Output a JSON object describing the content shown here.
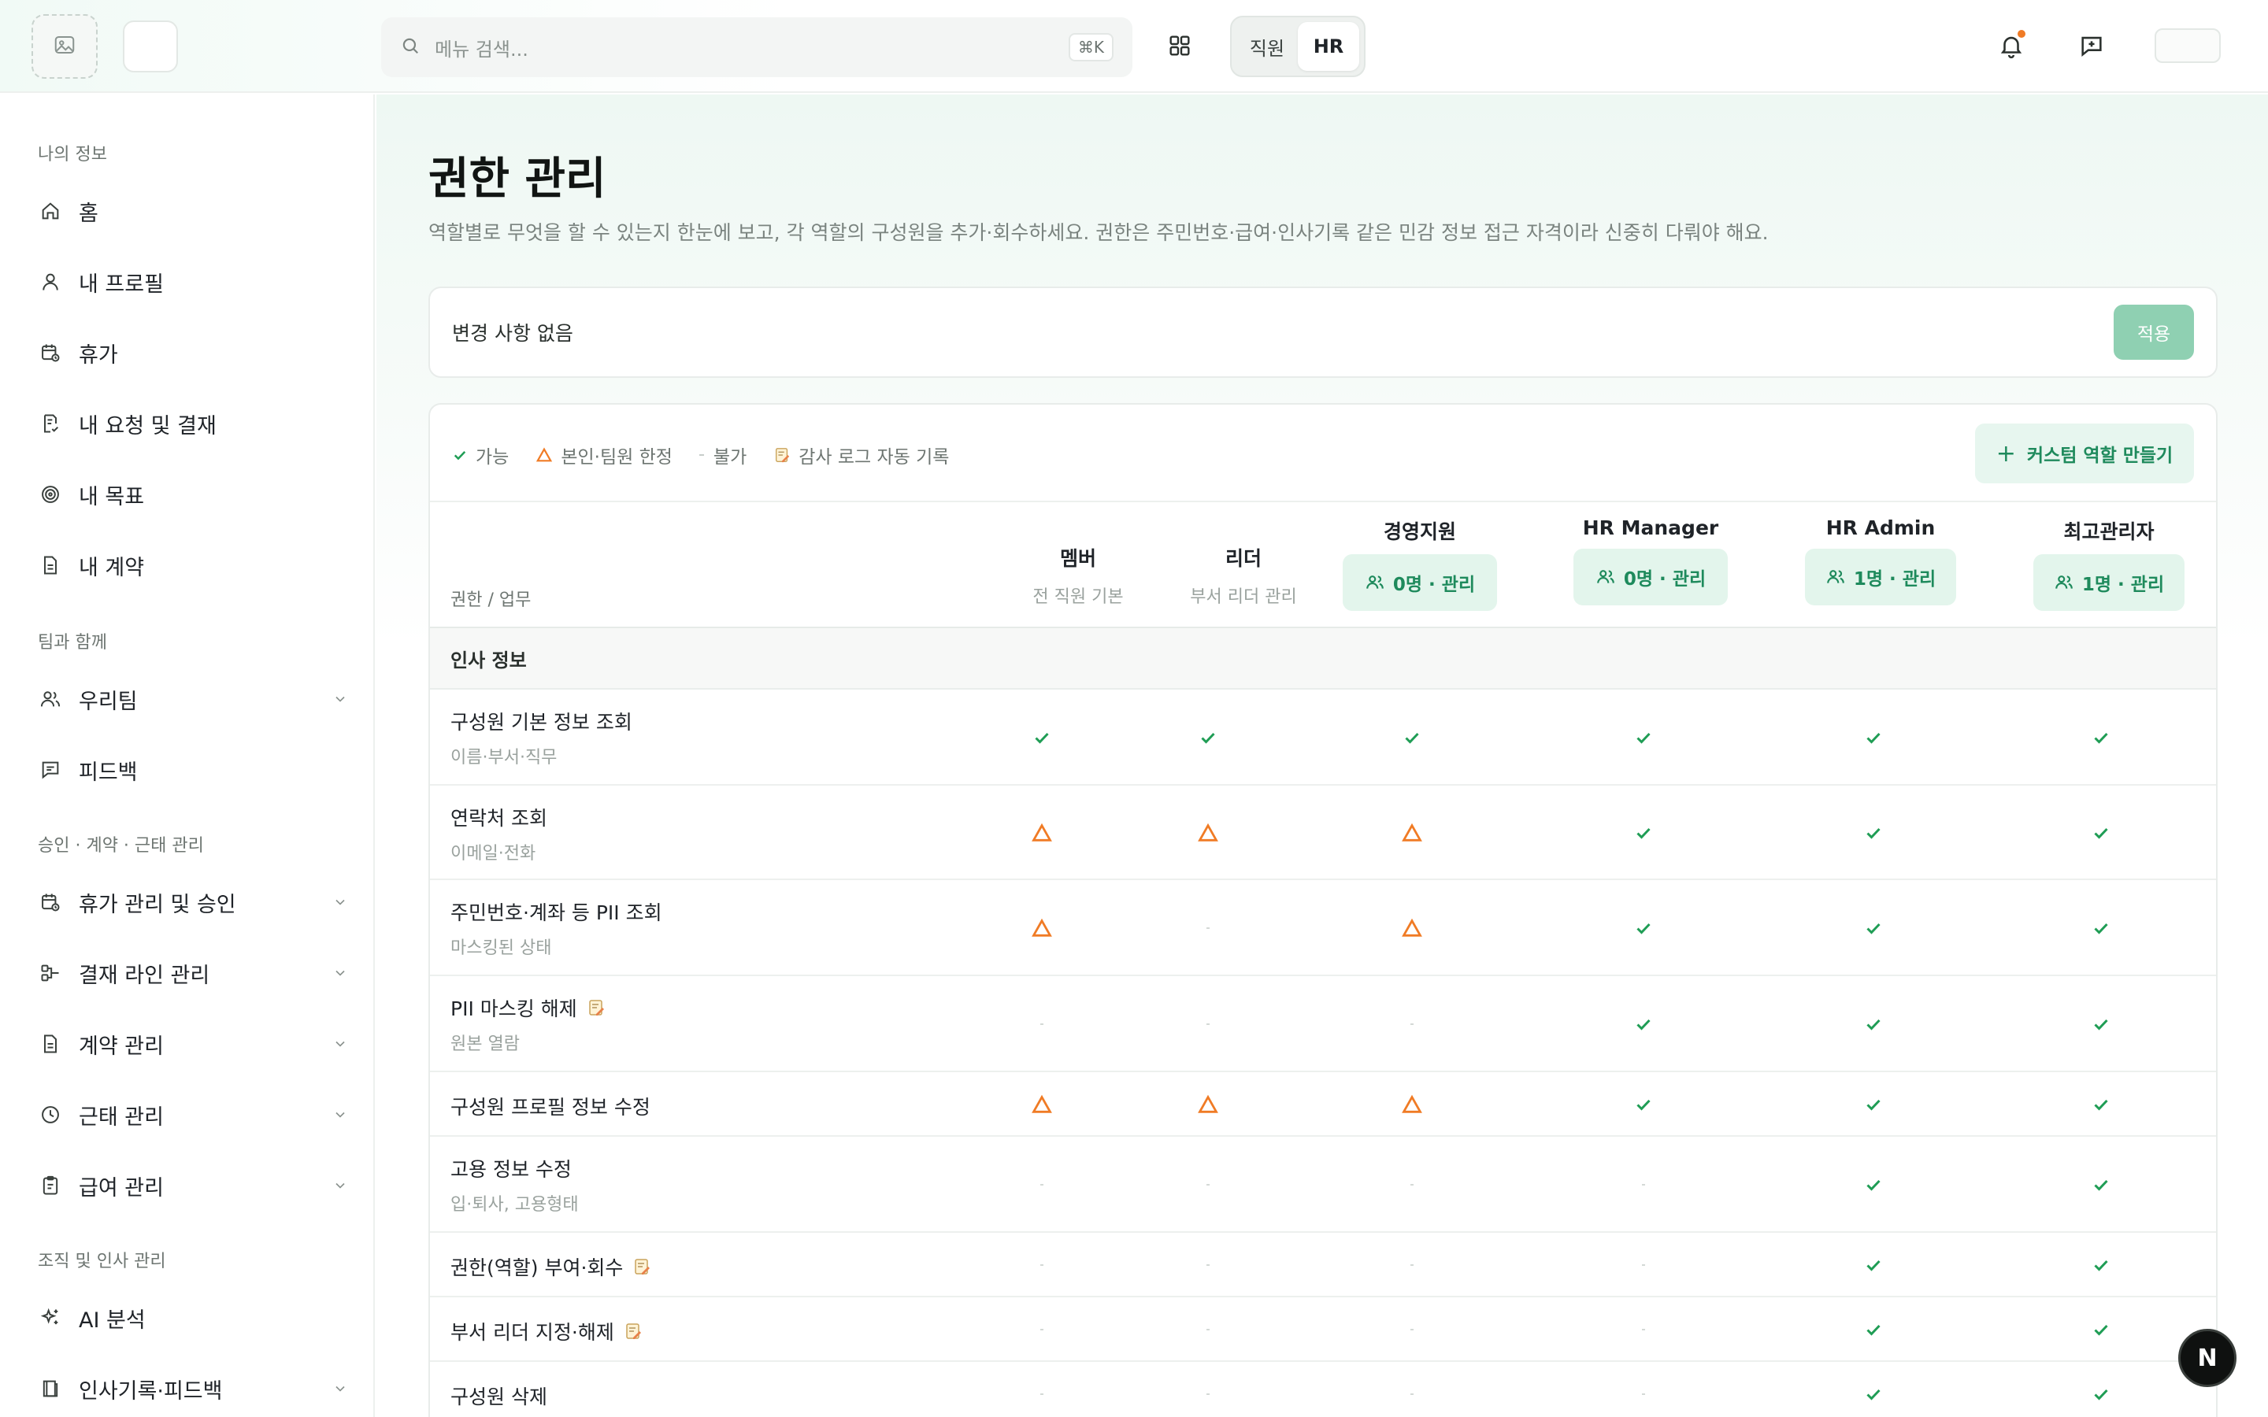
{
  "header": {
    "search_placeholder": "메뉴 검색...",
    "search_shortcut": "⌘K",
    "mode_options": [
      "직원",
      "HR"
    ],
    "mode_selected": "HR",
    "notification_dot_color": "#f07b25"
  },
  "sidebar": {
    "groups": [
      {
        "label": "나의 정보",
        "items": [
          {
            "label": "홈",
            "icon": "home-icon"
          },
          {
            "label": "내 프로필",
            "icon": "user-icon"
          },
          {
            "label": "휴가",
            "icon": "calendar-icon"
          },
          {
            "label": "내 요청 및 결재",
            "icon": "document-check-icon"
          },
          {
            "label": "내 목표",
            "icon": "target-icon"
          },
          {
            "label": "내 계약",
            "icon": "file-icon"
          }
        ]
      },
      {
        "label": "팀과 함께",
        "items": [
          {
            "label": "우리팀",
            "icon": "users-icon",
            "expandable": true
          },
          {
            "label": "피드백",
            "icon": "message-icon"
          }
        ]
      },
      {
        "label": "승인 · 계약 · 근태 관리",
        "items": [
          {
            "label": "휴가 관리 및 승인",
            "icon": "calendar-icon",
            "expandable": true
          },
          {
            "label": "결재 라인 관리",
            "icon": "flow-icon",
            "expandable": true
          },
          {
            "label": "계약 관리",
            "icon": "file-icon",
            "expandable": true
          },
          {
            "label": "근태 관리",
            "icon": "clock-icon",
            "expandable": true
          },
          {
            "label": "급여 관리",
            "icon": "clipboard-icon",
            "expandable": true
          }
        ]
      },
      {
        "label": "조직 및 인사 관리",
        "items": [
          {
            "label": "AI 분석",
            "icon": "sparkle-icon"
          },
          {
            "label": "인사기록·피드백",
            "icon": "book-icon",
            "expandable": true
          }
        ]
      }
    ]
  },
  "page": {
    "title": "권한 관리",
    "description": "역할별로 무엇을 할 수 있는지 한눈에 보고, 각 역할의 구성원을 추가·회수하세요. 권한은 주민번호·급여·인사기록 같은 민감 정보 접근 자격이라 신중히 다뤄야 해요.",
    "change_status": "변경 사항 없음",
    "apply_label": "적용"
  },
  "legend": {
    "allowed": "가능",
    "limited": "본인·팀원 한정",
    "denied": "불가",
    "audit": "감사 로그 자동 기록",
    "custom_role_label": "커스텀 역할 만들기"
  },
  "table": {
    "header_label": "권한 / 업무",
    "roles": [
      {
        "name": "멤버",
        "sub": "전 직원 기본"
      },
      {
        "name": "리더",
        "sub": "부서 리더 관리"
      },
      {
        "name": "경영지원",
        "chip": "0명 · 관리"
      },
      {
        "name": "HR Manager",
        "chip": "0명 · 관리"
      },
      {
        "name": "HR Admin",
        "chip": "1명 · 관리"
      },
      {
        "name": "최고관리자",
        "chip": "1명 · 관리"
      }
    ],
    "section": "인사 정보",
    "rows": [
      {
        "title": "구성원 기본 정보 조회",
        "sub": "이름·부서·직무",
        "audit": false,
        "cells": [
          "yes",
          "yes",
          "yes",
          "yes",
          "yes",
          "yes"
        ]
      },
      {
        "title": "연락처 조회",
        "sub": "이메일·전화",
        "audit": false,
        "cells": [
          "limited",
          "limited",
          "limited",
          "yes",
          "yes",
          "yes"
        ]
      },
      {
        "title": "주민번호·계좌 등 PII 조회",
        "sub": "마스킹된 상태",
        "audit": false,
        "cells": [
          "limited",
          "no",
          "limited",
          "yes",
          "yes",
          "yes"
        ]
      },
      {
        "title": "PII 마스킹 해제",
        "sub": "원본 열람",
        "audit": true,
        "cells": [
          "no",
          "no",
          "no",
          "yes",
          "yes",
          "yes"
        ]
      },
      {
        "title": "구성원 프로필 정보 수정",
        "sub": "",
        "audit": false,
        "cells": [
          "limited",
          "limited",
          "limited",
          "yes",
          "yes",
          "yes"
        ]
      },
      {
        "title": "고용 정보 수정",
        "sub": "입·퇴사, 고용형태",
        "audit": false,
        "cells": [
          "no",
          "no",
          "no",
          "no",
          "yes",
          "yes"
        ]
      },
      {
        "title": "권한(역할) 부여·회수",
        "sub": "",
        "audit": true,
        "cells": [
          "no",
          "no",
          "no",
          "no",
          "yes",
          "yes"
        ]
      },
      {
        "title": "부서 리더 지정·해제",
        "sub": "",
        "audit": true,
        "cells": [
          "no",
          "no",
          "no",
          "no",
          "yes",
          "yes"
        ]
      },
      {
        "title": "구성원 삭제",
        "sub": "",
        "audit": false,
        "cells": [
          "no",
          "no",
          "no",
          "no",
          "yes",
          "yes"
        ]
      }
    ]
  },
  "fab_label": "N",
  "colors": {
    "accent": "#1e8a5c",
    "check": "#1f9d55",
    "warning": "#f07b25",
    "apply": "#8fd0b2"
  }
}
